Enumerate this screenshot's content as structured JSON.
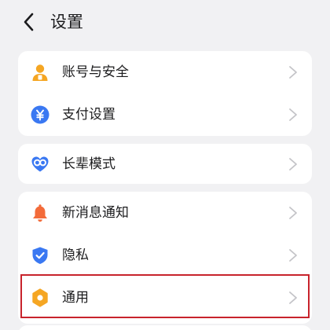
{
  "header": {
    "title": "设置"
  },
  "groups": [
    {
      "items": [
        {
          "label": "账号与安全",
          "icon": "user-account-icon"
        },
        {
          "label": "支付设置",
          "icon": "yuan-payment-icon"
        }
      ]
    },
    {
      "items": [
        {
          "label": "长辈模式",
          "icon": "elder-mode-heart-icon"
        }
      ]
    },
    {
      "items": [
        {
          "label": "新消息通知",
          "icon": "bell-icon"
        },
        {
          "label": "隐私",
          "icon": "shield-check-icon"
        },
        {
          "label": "通用",
          "icon": "gear-icon",
          "highlighted": true
        }
      ]
    }
  ],
  "colors": {
    "background": "#f1f1f3",
    "card": "#ffffff",
    "orange": "#f5a623",
    "blue": "#3a78f2",
    "red_orange": "#f36b3a",
    "highlight_border": "#c8232c",
    "chevron": "#c4c4c8"
  }
}
